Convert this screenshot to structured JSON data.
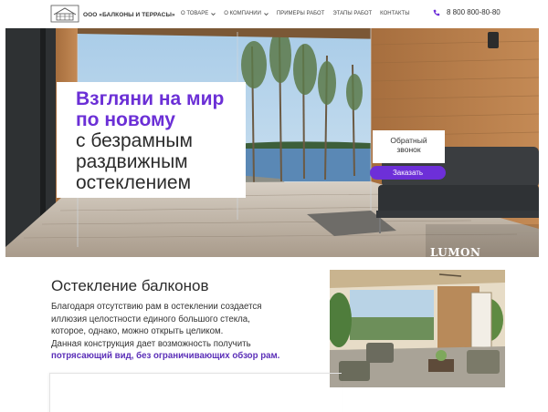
{
  "header": {
    "company_name": "ООО «БАЛКОНЫ И ТЕРРАСЫ»",
    "logo_icon": "house-logo-icon",
    "nav": [
      {
        "label": "О ТОВАРЕ",
        "has_dropdown": true
      },
      {
        "label": "О КОМПАНИИ",
        "has_dropdown": true
      },
      {
        "label": "ПРИМЕРЫ РАБОТ",
        "has_dropdown": false
      },
      {
        "label": "ЭТАПЫ РАБОТ",
        "has_dropdown": false
      },
      {
        "label": "КОНТАКТЫ",
        "has_dropdown": false
      }
    ],
    "phone_icon": "phone-icon",
    "phone": "8 800 800-80-80"
  },
  "hero": {
    "lines": [
      "Взгляни на мир",
      "по новому",
      "с безрамным",
      "раздвижным",
      "остеклением"
    ],
    "callback_line1": "Обратный",
    "callback_line2": "звонок",
    "order_button": "Заказать",
    "brand": "LUMON"
  },
  "section": {
    "title": "Остекление балконов",
    "body_lines": [
      "Благодаря отсутствию рам в остеклении создается",
      "иллюзия целостности единого большого стекла,",
      "которое, однако, можно открыть целиком.",
      "Данная конструкция дает возможность получить"
    ],
    "highlight": "потрясающий вид, без ограничивающих обзор рам."
  },
  "colors": {
    "accent": "#6d2fd8",
    "text": "#2b2b2b",
    "wood": "#b07a4a"
  }
}
